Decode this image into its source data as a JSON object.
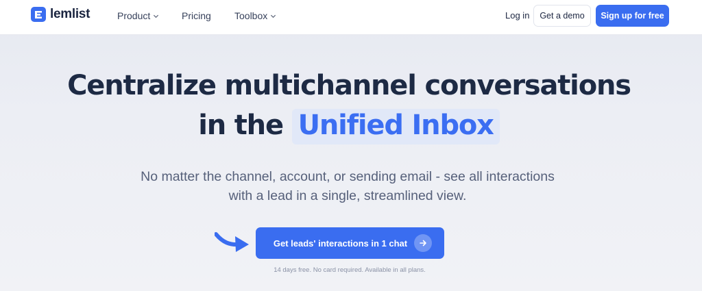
{
  "brand": {
    "name": "lemlist",
    "logo_icon": "lemlist-logo-icon",
    "accent": "#3a6df0"
  },
  "nav": {
    "items": [
      {
        "label": "Product",
        "has_dropdown": true
      },
      {
        "label": "Pricing",
        "has_dropdown": false
      },
      {
        "label": "Toolbox",
        "has_dropdown": true
      }
    ],
    "login_label": "Log in",
    "demo_label": "Get a demo",
    "signup_label": "Sign up for free"
  },
  "hero": {
    "title_line1": "Centralize multichannel conversations",
    "title_line2_prefix": "in the",
    "title_highlight": "Unified Inbox",
    "subtitle_line1": "No matter the channel, account, or sending email - see all interactions",
    "subtitle_line2": "with a lead in a single, streamlined view.",
    "cta_label": "Get leads' interactions in 1 chat",
    "note": "14 days free. No card required. Available in all plans."
  }
}
